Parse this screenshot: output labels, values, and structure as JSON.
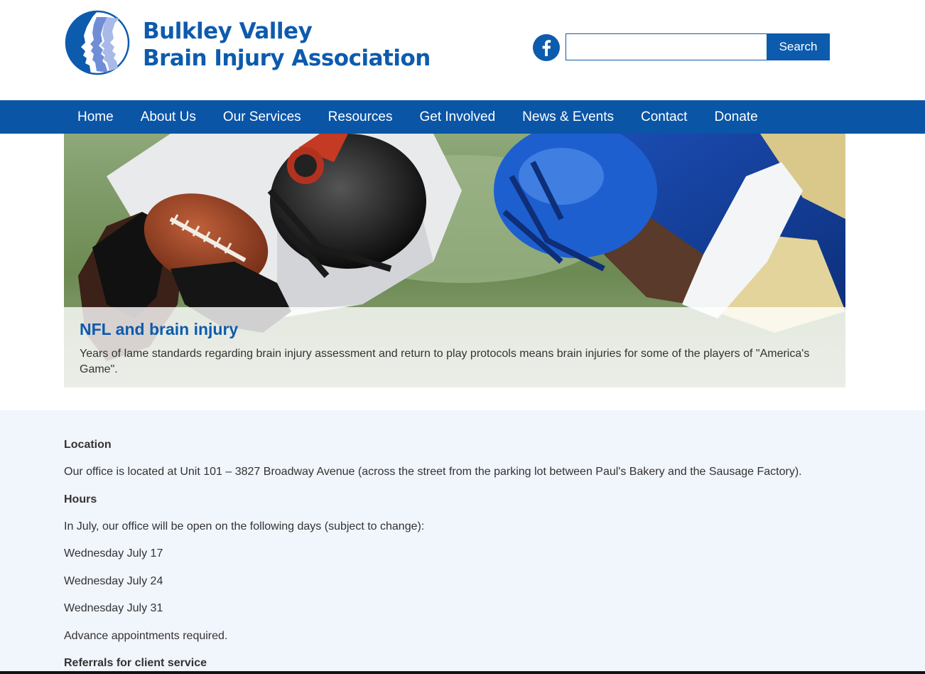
{
  "header": {
    "logo_line1": "Bulkley Valley",
    "logo_line2": "Brain Injury Association",
    "search_placeholder": "",
    "search_button_label": "Search",
    "social_icon": "facebook-icon"
  },
  "nav": {
    "items": [
      {
        "label": "Home"
      },
      {
        "label": "About Us"
      },
      {
        "label": "Our Services"
      },
      {
        "label": "Resources"
      },
      {
        "label": "Get Involved"
      },
      {
        "label": "News & Events"
      },
      {
        "label": "Contact"
      },
      {
        "label": "Donate"
      }
    ]
  },
  "hero": {
    "title": "NFL and brain injury",
    "description": "Years of lame standards regarding brain injury assessment and return to play protocols means brain injuries for some of the players of \"America's Game\"."
  },
  "content": {
    "location_heading": "Location",
    "location_text": "Our office is located at Unit 101 – 3827 Broadway Avenue (across the street from the parking lot between Paul's Bakery and the Sausage Factory).",
    "hours_heading": "Hours",
    "hours_intro": "In July, our office will be open on the following days (subject to change):",
    "days": [
      "Wednesday July 17",
      "Wednesday July 24",
      "Wednesday July 31"
    ],
    "appointments_note": "Advance appointments required.",
    "referrals_heading": "Referrals for client service"
  },
  "colors": {
    "brand_blue": "#0d5bad",
    "nav_blue": "#0a55a6",
    "content_background": "#f1f5fc",
    "text": "#333333"
  }
}
